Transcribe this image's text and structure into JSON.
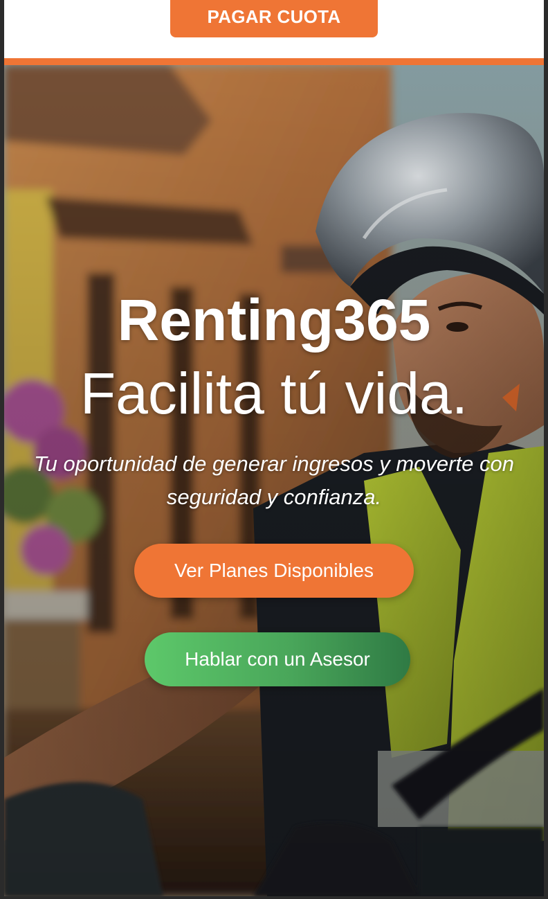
{
  "header": {
    "pay_button_label": "PAGAR CUOTA"
  },
  "hero": {
    "brand": "Renting365",
    "tagline": "Facilita tú vida.",
    "subtitle": "Tu oportunidad de generar ingresos y moverte con seguridad y confianza.",
    "cta_primary": "Ver Planes Disponibles",
    "cta_secondary": "Hablar con un Asesor"
  },
  "colors": {
    "brand_orange": "#ef7535",
    "advisor_green_start": "#5dc86a",
    "advisor_green_end": "#2f7a44",
    "text_on_hero": "#ffffff"
  }
}
